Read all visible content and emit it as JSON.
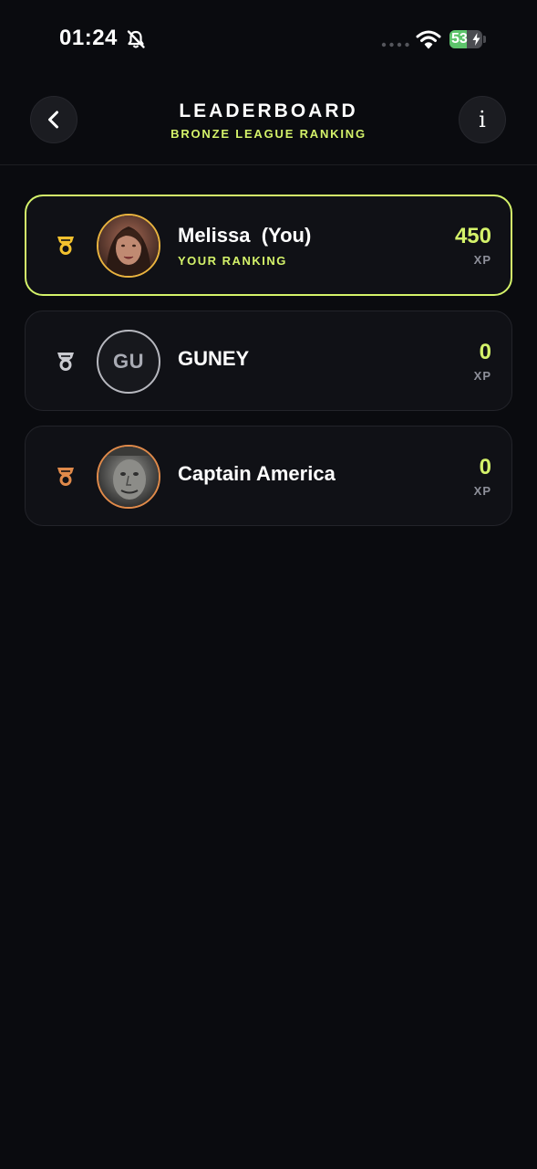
{
  "status_bar": {
    "time": "01:24",
    "battery_percent": "53",
    "battery_level": 0.53,
    "icons": [
      "bell-slash-icon",
      "signal-icon",
      "wifi-icon",
      "battery-charging-icon"
    ]
  },
  "header": {
    "title": "LEADERBOARD",
    "subtitle": "BRONZE LEAGUE RANKING",
    "back_icon": "chevron-left-icon",
    "info_icon": "info-icon"
  },
  "leaderboard": [
    {
      "name": "Melissa  (You)",
      "rank_label": "YOUR RANKING",
      "xp": "450",
      "xp_unit": "XP",
      "medal_color": "#f2c12e",
      "avatar": "photo"
    },
    {
      "name": "GUNEY",
      "initials": "GU",
      "xp": "0",
      "xp_unit": "XP",
      "medal_color": "#c9cad0",
      "avatar": "initials"
    },
    {
      "name": "Captain America",
      "xp": "0",
      "xp_unit": "XP",
      "medal_color": "#e08a4a",
      "avatar": "photo"
    }
  ],
  "colors": {
    "background": "#0a0b0f",
    "accent": "#d4f26a",
    "card": "#101116"
  }
}
